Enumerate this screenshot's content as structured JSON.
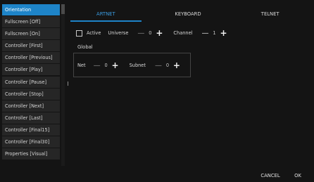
{
  "sidebar": {
    "items": [
      {
        "label": "Orientation",
        "selected": true
      },
      {
        "label": "Fullscreen [Off]"
      },
      {
        "label": "Fullscreen [On]"
      },
      {
        "label": "Controller [First]"
      },
      {
        "label": "Controller [Previous]"
      },
      {
        "label": "Controller [Play]"
      },
      {
        "label": "Controller [Pause]"
      },
      {
        "label": "Controller [Stop]"
      },
      {
        "label": "Controller [Next]"
      },
      {
        "label": "Controller [Last]"
      },
      {
        "label": "Controller [Final15]"
      },
      {
        "label": "Controller [Final30]"
      },
      {
        "label": "Properties [Visual]"
      }
    ]
  },
  "tabs": [
    {
      "label": "ARTNET",
      "active": true
    },
    {
      "label": "KEYBOARD"
    },
    {
      "label": "TELNET"
    }
  ],
  "artnet": {
    "active_label": "Active",
    "active_checked": false,
    "universe_label": "Universe",
    "universe_value": "0",
    "channel_label": "Channel",
    "channel_value": "1",
    "global_label": "Global",
    "net_label": "Net",
    "net_value": "0",
    "subnet_label": "Subnet",
    "subnet_value": "0"
  },
  "symbols": {
    "minus": "—",
    "plus": "+"
  },
  "buttons": {
    "cancel": "CANCEL",
    "ok": "OK"
  },
  "colors": {
    "accent": "#1e84c8",
    "background": "#141414",
    "sidebar_item": "#262626"
  }
}
